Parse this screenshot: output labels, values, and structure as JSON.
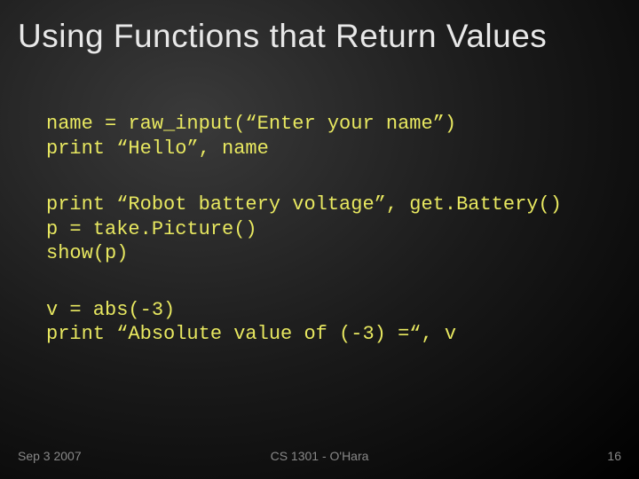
{
  "title": "Using Functions that Return Values",
  "code": {
    "block1": "name = raw_input(“Enter your name”)\nprint “Hello”, name",
    "block2": "print “Robot battery voltage”, get.Battery()\np = take.Picture()\nshow(p)",
    "block3": "v = abs(-3)\nprint “Absolute value of (-3) =“, v"
  },
  "footer": {
    "date": "Sep 3 2007",
    "course": "CS 1301 - O'Hara",
    "page": "16"
  }
}
